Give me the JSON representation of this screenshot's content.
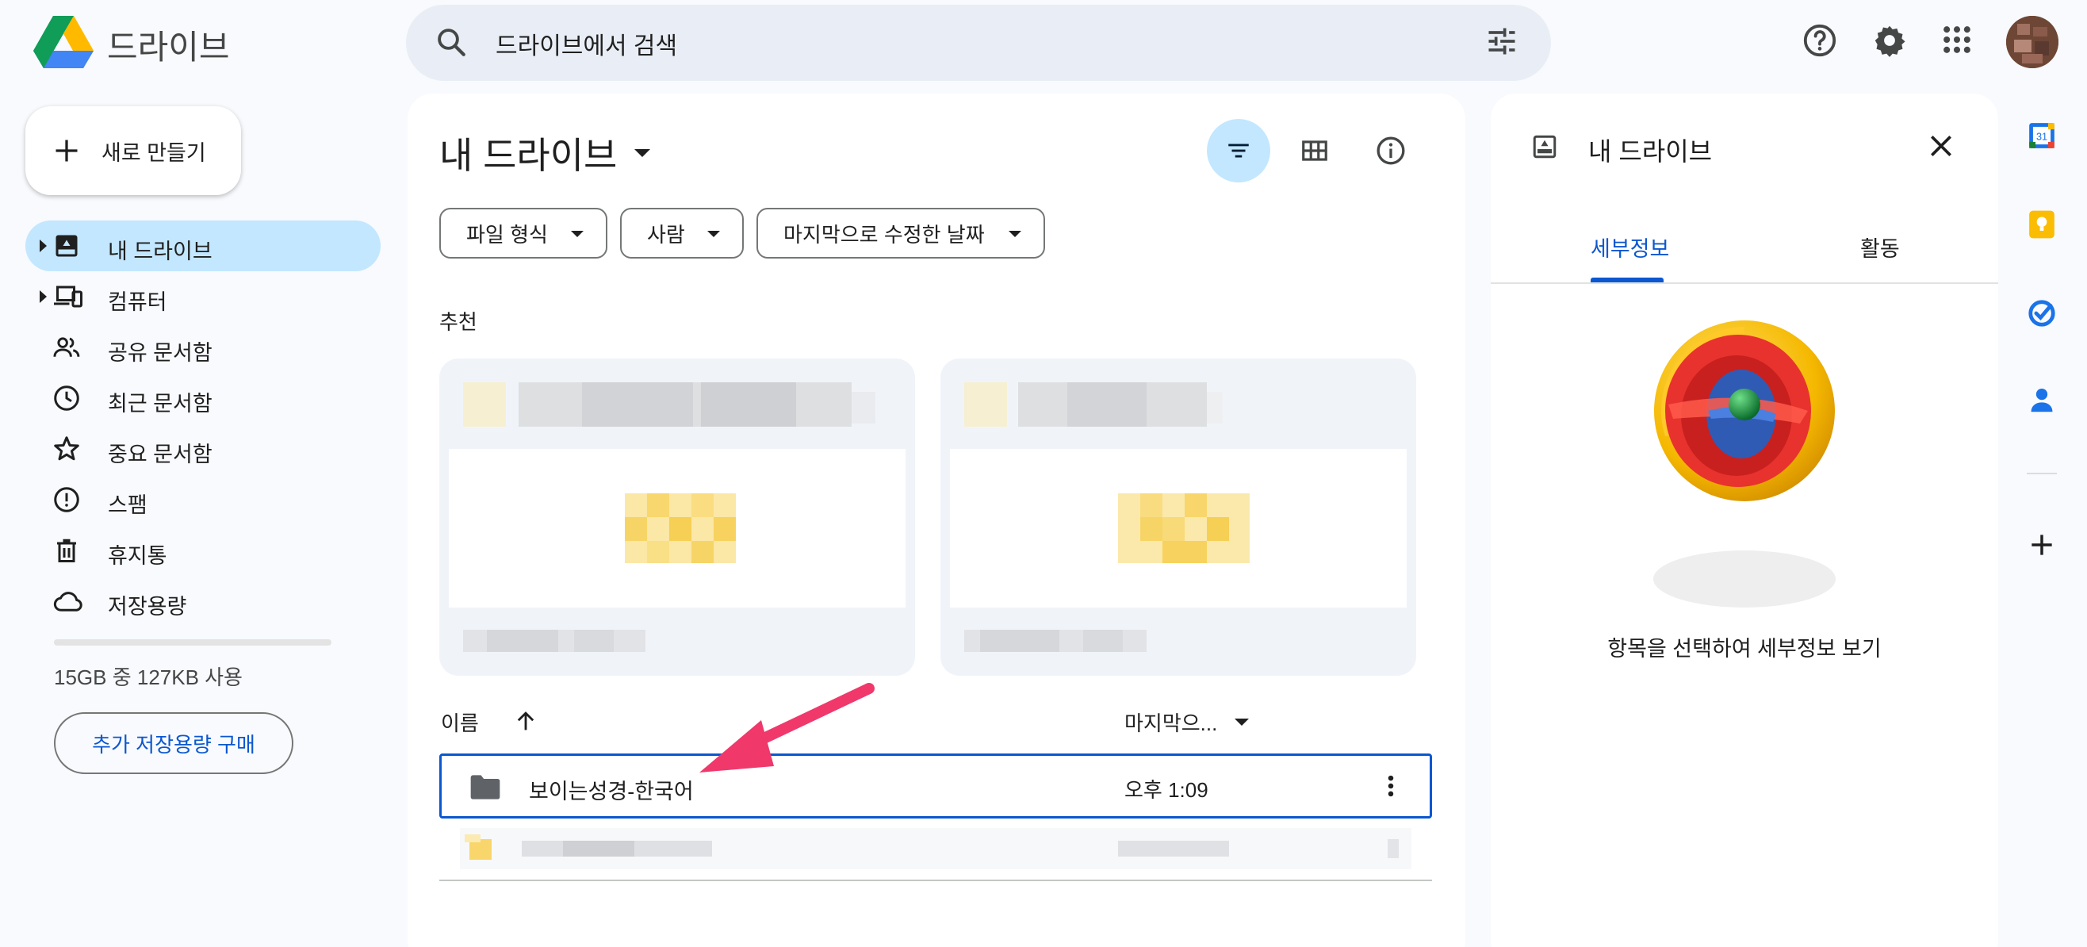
{
  "header": {
    "app_title": "드라이브",
    "search_placeholder": "드라이브에서 검색",
    "icons": [
      "drive-logo",
      "search-icon",
      "tune-icon",
      "help-icon",
      "settings-icon",
      "apps-icon",
      "account-avatar"
    ]
  },
  "sidebar": {
    "new_button": "새로 만들기",
    "items": [
      {
        "label": "내 드라이브",
        "icon": "my-drive-icon",
        "active": true
      },
      {
        "label": "컴퓨터",
        "icon": "computers-icon"
      },
      {
        "label": "공유 문서함",
        "icon": "shared-icon"
      },
      {
        "label": "최근 문서함",
        "icon": "clock-icon"
      },
      {
        "label": "중요 문서함",
        "icon": "star-icon"
      },
      {
        "label": "스팸",
        "icon": "spam-icon"
      },
      {
        "label": "휴지통",
        "icon": "trash-icon"
      },
      {
        "label": "저장용량",
        "icon": "cloud-icon"
      }
    ],
    "storage_text": "15GB 중 127KB 사용",
    "buy_storage": "추가 저장용량 구매"
  },
  "main": {
    "title": "내 드라이브",
    "filters": [
      "파일 형식",
      "사람",
      "마지막으로 수정한 날짜"
    ],
    "suggested_title": "추천",
    "columns": {
      "name": "이름",
      "modified": "마지막으..."
    },
    "rows": [
      {
        "name": "보이는성경-한국어",
        "modified": "오후 1:09",
        "type": "folder",
        "selected": true
      }
    ]
  },
  "details": {
    "title": "내 드라이브",
    "tabs": [
      "세부정보",
      "활동"
    ],
    "active_tab": "세부정보",
    "message": "항목을 선택하여 세부정보 보기"
  },
  "side_panel": {
    "calendar_day": "31",
    "apps": [
      "calendar-icon",
      "keep-icon",
      "tasks-icon",
      "contacts-icon",
      "add-icon"
    ]
  },
  "colors": {
    "accent": "#0b57d0",
    "active_nav": "#c2e7ff",
    "annotation_arrow": "#f0386b"
  }
}
